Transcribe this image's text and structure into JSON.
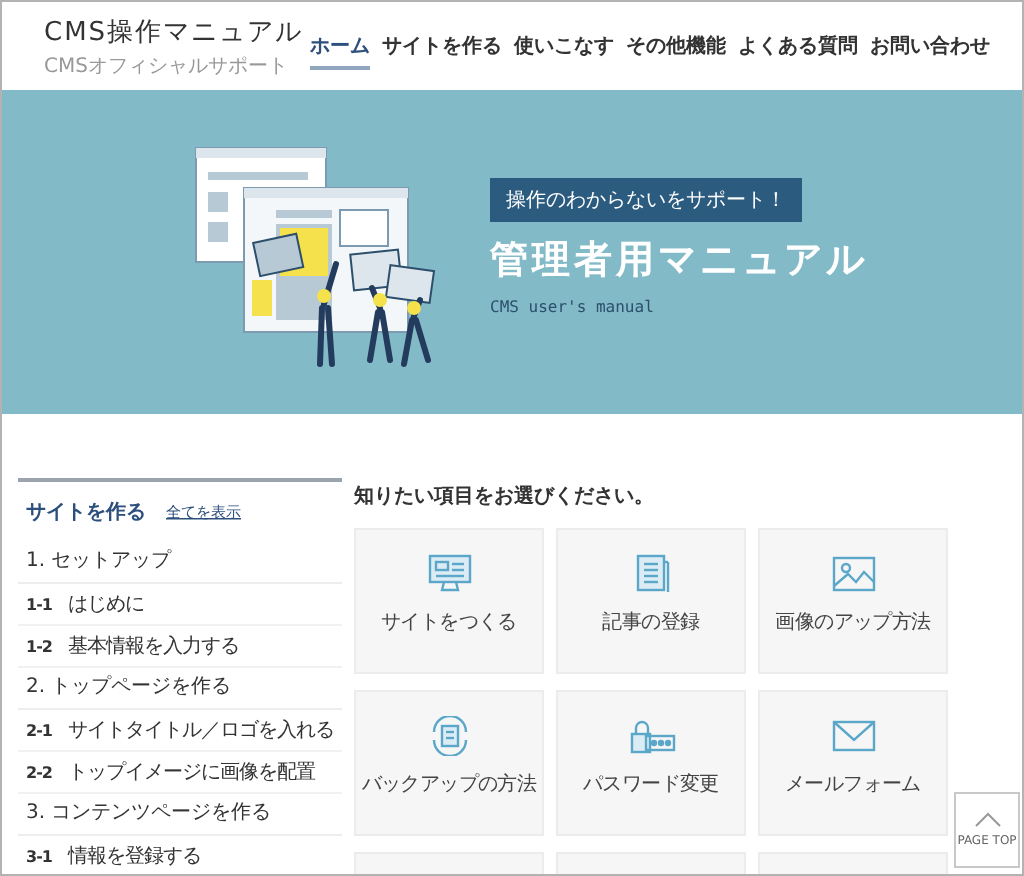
{
  "header": {
    "logo_title": "CMS操作マニュアル",
    "logo_subtitle": "CMSオフィシャルサポート",
    "nav": [
      {
        "label": "ホーム",
        "selected": true
      },
      {
        "label": "サイトを作る",
        "selected": false
      },
      {
        "label": "使いこなす",
        "selected": false
      },
      {
        "label": "その他機能",
        "selected": false
      },
      {
        "label": "よくある質問",
        "selected": false
      },
      {
        "label": "お問い合わせ",
        "selected": false
      }
    ]
  },
  "hero": {
    "badge": "操作のわからないをサポート！",
    "title": "管理者用マニュアル",
    "subtitle": "CMS user's manual"
  },
  "sidebar": {
    "title": "サイトを作る",
    "show_all_link": "全てを表示",
    "sections": [
      {
        "heading": "1. セットアップ",
        "items": [
          {
            "number": "1-1",
            "label": "はじめに"
          },
          {
            "number": "1-2",
            "label": "基本情報を入力する"
          }
        ]
      },
      {
        "heading": "2. トップページを作る",
        "items": [
          {
            "number": "2-1",
            "label": "サイトタイトル／ロゴを入れる"
          },
          {
            "number": "2-2",
            "label": "トップイメージに画像を配置"
          }
        ]
      },
      {
        "heading": "3. コンテンツページを作る",
        "items": [
          {
            "number": "3-1",
            "label": "情報を登録する"
          }
        ]
      }
    ]
  },
  "main": {
    "heading": "知りたい項目をお選びください。",
    "cards": [
      {
        "kind": "monitor",
        "label": "サイトをつくる"
      },
      {
        "kind": "document",
        "label": "記事の登録"
      },
      {
        "kind": "image",
        "label": "画像のアップ方法"
      },
      {
        "kind": "backup",
        "label": "バックアップの方法"
      },
      {
        "kind": "password",
        "label": "パスワード変更"
      },
      {
        "kind": "mail",
        "label": "メールフォーム"
      },
      {
        "kind": "blank"
      },
      {
        "kind": "blank"
      },
      {
        "kind": "blank"
      }
    ]
  },
  "page_top": {
    "label": "PAGE TOP"
  }
}
